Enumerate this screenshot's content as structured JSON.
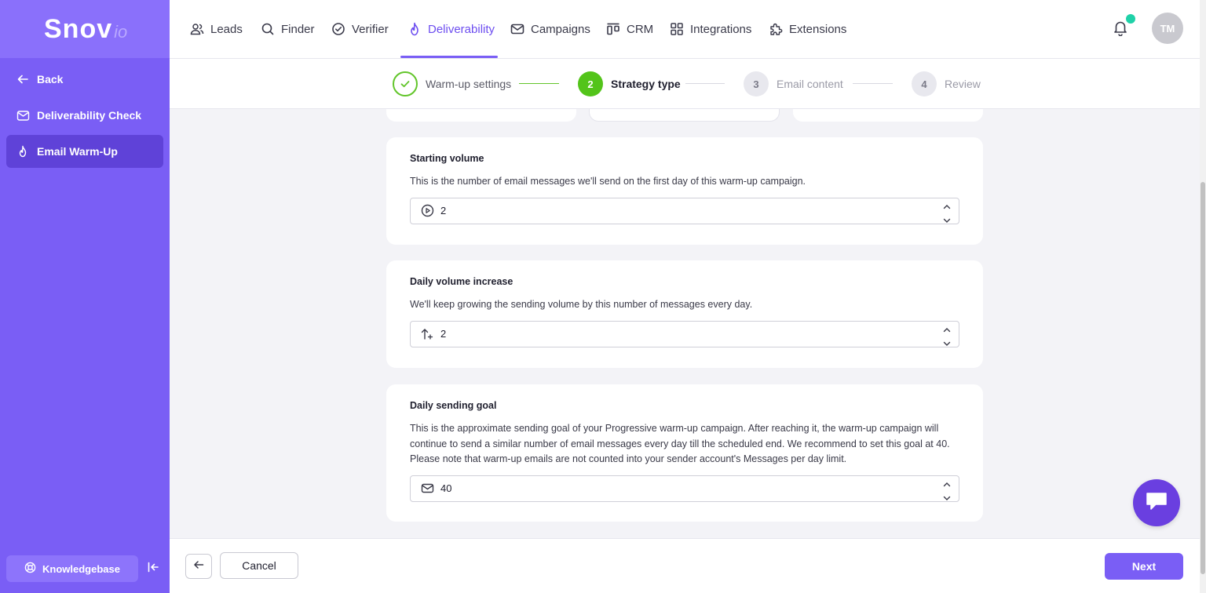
{
  "logo": {
    "main": "Snov",
    "sub": "io"
  },
  "sidebar": {
    "back_label": "Back",
    "items": [
      {
        "label": "Deliverability Check"
      },
      {
        "label": "Email Warm-Up"
      }
    ],
    "knowledgebase_label": "Knowledgebase"
  },
  "nav": {
    "items": [
      {
        "label": "Leads",
        "icon": "users-icon"
      },
      {
        "label": "Finder",
        "icon": "search-icon"
      },
      {
        "label": "Verifier",
        "icon": "check-circle-icon"
      },
      {
        "label": "Deliverability",
        "icon": "flame-icon",
        "active": true
      },
      {
        "label": "Campaigns",
        "icon": "mail-icon"
      },
      {
        "label": "CRM",
        "icon": "crm-icon"
      },
      {
        "label": "Integrations",
        "icon": "grid-icon"
      },
      {
        "label": "Extensions",
        "icon": "puzzle-icon"
      }
    ],
    "avatar_initials": "TM"
  },
  "stepper": {
    "steps": [
      {
        "number": "1",
        "label": "Warm-up settings",
        "state": "done"
      },
      {
        "number": "2",
        "label": "Strategy type",
        "state": "current"
      },
      {
        "number": "3",
        "label": "Email content",
        "state": "todo"
      },
      {
        "number": "4",
        "label": "Review",
        "state": "todo"
      }
    ]
  },
  "cards": {
    "starting_volume": {
      "title": "Starting volume",
      "description": "This is the number of email messages we'll send on the first day of this warm-up campaign.",
      "value": "2"
    },
    "daily_increase": {
      "title": "Daily volume increase",
      "description": "We'll keep growing the sending volume by this number of messages every day.",
      "value": "2"
    },
    "sending_goal": {
      "title": "Daily sending goal",
      "description": "This is the approximate sending goal of your Progressive warm-up campaign. After reaching it, the warm-up campaign will continue to send a similar number of email messages every day till the scheduled end. We recommend to set this goal at 40. Please note that warm-up emails are not counted into your sender account's Messages per day limit.",
      "value": "40"
    }
  },
  "footer": {
    "cancel_label": "Cancel",
    "next_label": "Next"
  },
  "colors": {
    "brand": "#7a5ef5",
    "step_done": "#62c52a",
    "notification_dot": "#1fd1a8"
  }
}
